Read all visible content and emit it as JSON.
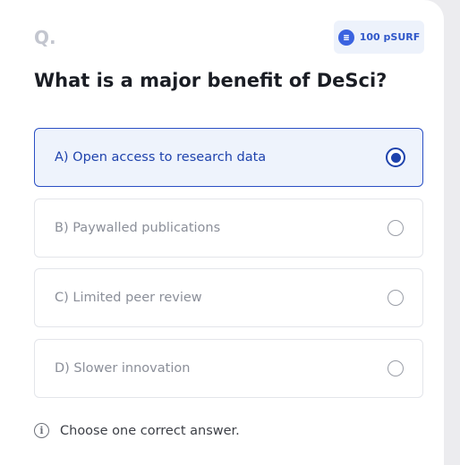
{
  "header": {
    "q_label": "Q.",
    "reward": {
      "icon": "coin-icon",
      "text": "100 pSURF"
    }
  },
  "question": "What is a major benefit of DeSci?",
  "options": [
    {
      "label": "A) Open access to research data",
      "selected": true
    },
    {
      "label": "B) Paywalled publications",
      "selected": false
    },
    {
      "label": "C) Limited peer review",
      "selected": false
    },
    {
      "label": "D) Slower innovation",
      "selected": false
    }
  ],
  "footer": {
    "icon": "info-icon",
    "text": "Choose one correct answer."
  },
  "colors": {
    "accent": "#1f43ad",
    "selected_bg": "#eef3fc",
    "badge_bg": "#edf2fb"
  }
}
